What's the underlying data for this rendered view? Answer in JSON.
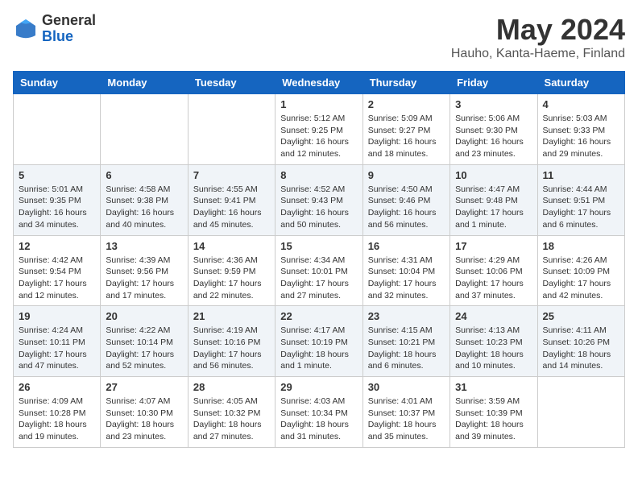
{
  "header": {
    "logo_general": "General",
    "logo_blue": "Blue",
    "month_year": "May 2024",
    "location": "Hauho, Kanta-Haeme, Finland"
  },
  "days_of_week": [
    "Sunday",
    "Monday",
    "Tuesday",
    "Wednesday",
    "Thursday",
    "Friday",
    "Saturday"
  ],
  "weeks": [
    [
      {
        "day": "",
        "info": ""
      },
      {
        "day": "",
        "info": ""
      },
      {
        "day": "",
        "info": ""
      },
      {
        "day": "1",
        "info": "Sunrise: 5:12 AM\nSunset: 9:25 PM\nDaylight: 16 hours\nand 12 minutes."
      },
      {
        "day": "2",
        "info": "Sunrise: 5:09 AM\nSunset: 9:27 PM\nDaylight: 16 hours\nand 18 minutes."
      },
      {
        "day": "3",
        "info": "Sunrise: 5:06 AM\nSunset: 9:30 PM\nDaylight: 16 hours\nand 23 minutes."
      },
      {
        "day": "4",
        "info": "Sunrise: 5:03 AM\nSunset: 9:33 PM\nDaylight: 16 hours\nand 29 minutes."
      }
    ],
    [
      {
        "day": "5",
        "info": "Sunrise: 5:01 AM\nSunset: 9:35 PM\nDaylight: 16 hours\nand 34 minutes."
      },
      {
        "day": "6",
        "info": "Sunrise: 4:58 AM\nSunset: 9:38 PM\nDaylight: 16 hours\nand 40 minutes."
      },
      {
        "day": "7",
        "info": "Sunrise: 4:55 AM\nSunset: 9:41 PM\nDaylight: 16 hours\nand 45 minutes."
      },
      {
        "day": "8",
        "info": "Sunrise: 4:52 AM\nSunset: 9:43 PM\nDaylight: 16 hours\nand 50 minutes."
      },
      {
        "day": "9",
        "info": "Sunrise: 4:50 AM\nSunset: 9:46 PM\nDaylight: 16 hours\nand 56 minutes."
      },
      {
        "day": "10",
        "info": "Sunrise: 4:47 AM\nSunset: 9:48 PM\nDaylight: 17 hours\nand 1 minute."
      },
      {
        "day": "11",
        "info": "Sunrise: 4:44 AM\nSunset: 9:51 PM\nDaylight: 17 hours\nand 6 minutes."
      }
    ],
    [
      {
        "day": "12",
        "info": "Sunrise: 4:42 AM\nSunset: 9:54 PM\nDaylight: 17 hours\nand 12 minutes."
      },
      {
        "day": "13",
        "info": "Sunrise: 4:39 AM\nSunset: 9:56 PM\nDaylight: 17 hours\nand 17 minutes."
      },
      {
        "day": "14",
        "info": "Sunrise: 4:36 AM\nSunset: 9:59 PM\nDaylight: 17 hours\nand 22 minutes."
      },
      {
        "day": "15",
        "info": "Sunrise: 4:34 AM\nSunset: 10:01 PM\nDaylight: 17 hours\nand 27 minutes."
      },
      {
        "day": "16",
        "info": "Sunrise: 4:31 AM\nSunset: 10:04 PM\nDaylight: 17 hours\nand 32 minutes."
      },
      {
        "day": "17",
        "info": "Sunrise: 4:29 AM\nSunset: 10:06 PM\nDaylight: 17 hours\nand 37 minutes."
      },
      {
        "day": "18",
        "info": "Sunrise: 4:26 AM\nSunset: 10:09 PM\nDaylight: 17 hours\nand 42 minutes."
      }
    ],
    [
      {
        "day": "19",
        "info": "Sunrise: 4:24 AM\nSunset: 10:11 PM\nDaylight: 17 hours\nand 47 minutes."
      },
      {
        "day": "20",
        "info": "Sunrise: 4:22 AM\nSunset: 10:14 PM\nDaylight: 17 hours\nand 52 minutes."
      },
      {
        "day": "21",
        "info": "Sunrise: 4:19 AM\nSunset: 10:16 PM\nDaylight: 17 hours\nand 56 minutes."
      },
      {
        "day": "22",
        "info": "Sunrise: 4:17 AM\nSunset: 10:19 PM\nDaylight: 18 hours\nand 1 minute."
      },
      {
        "day": "23",
        "info": "Sunrise: 4:15 AM\nSunset: 10:21 PM\nDaylight: 18 hours\nand 6 minutes."
      },
      {
        "day": "24",
        "info": "Sunrise: 4:13 AM\nSunset: 10:23 PM\nDaylight: 18 hours\nand 10 minutes."
      },
      {
        "day": "25",
        "info": "Sunrise: 4:11 AM\nSunset: 10:26 PM\nDaylight: 18 hours\nand 14 minutes."
      }
    ],
    [
      {
        "day": "26",
        "info": "Sunrise: 4:09 AM\nSunset: 10:28 PM\nDaylight: 18 hours\nand 19 minutes."
      },
      {
        "day": "27",
        "info": "Sunrise: 4:07 AM\nSunset: 10:30 PM\nDaylight: 18 hours\nand 23 minutes."
      },
      {
        "day": "28",
        "info": "Sunrise: 4:05 AM\nSunset: 10:32 PM\nDaylight: 18 hours\nand 27 minutes."
      },
      {
        "day": "29",
        "info": "Sunrise: 4:03 AM\nSunset: 10:34 PM\nDaylight: 18 hours\nand 31 minutes."
      },
      {
        "day": "30",
        "info": "Sunrise: 4:01 AM\nSunset: 10:37 PM\nDaylight: 18 hours\nand 35 minutes."
      },
      {
        "day": "31",
        "info": "Sunrise: 3:59 AM\nSunset: 10:39 PM\nDaylight: 18 hours\nand 39 minutes."
      },
      {
        "day": "",
        "info": ""
      }
    ]
  ]
}
